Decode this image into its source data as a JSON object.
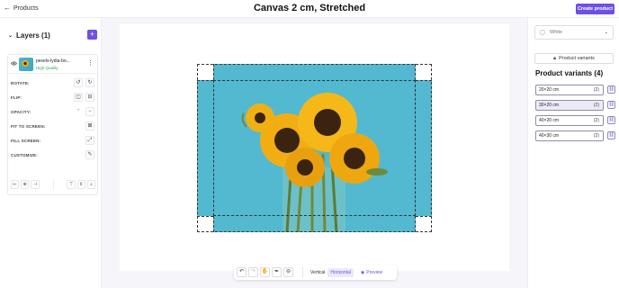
{
  "header": {
    "back_label": "Products",
    "title": "Canvas 2 cm, Stretched",
    "create_label": "Create product"
  },
  "layers": {
    "title": "Layers (1)",
    "add_label": "+",
    "file": {
      "name": "pexels-lydia-bo...",
      "quality": "High Quality"
    },
    "props": {
      "rotate": "ROTATE:",
      "flip": "FLIP:",
      "opacity": "OPACITY:",
      "fit": "FIT TO SCREEN:",
      "fill": "FILL SCREEN:",
      "customize": "CUSTOMIZE:"
    }
  },
  "toolbar": {
    "vertical": "Vertical",
    "horizontal": "Horizontal",
    "preview": "Preview"
  },
  "right": {
    "color_select": "White",
    "variants_button": "Product variants",
    "variants_title": "Product variants (4)",
    "variants": [
      {
        "label": "20×20 cm",
        "count": "(2)"
      },
      {
        "label": "30×20 cm",
        "count": "(2)"
      },
      {
        "label": "40×20 cm",
        "count": "(2)"
      },
      {
        "label": "40×30 cm",
        "count": "(2)"
      }
    ]
  },
  "colors": {
    "accent": "#6e4fe8",
    "photo_bg": "#4db5cc",
    "quality_green": "#34a25a"
  }
}
